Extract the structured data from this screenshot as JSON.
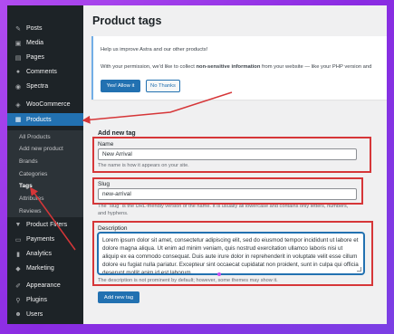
{
  "colors": {
    "admin_bar_bg": "#1d2327",
    "active_menu_bg": "#2271b1",
    "primary_button": "#2271b1",
    "highlight_red": "#d63638",
    "background_gradient": "#8a2be2"
  },
  "sidebar": {
    "items": [
      {
        "label": "Posts",
        "icon": "pin-icon"
      },
      {
        "label": "Media",
        "icon": "media-icon"
      },
      {
        "label": "Pages",
        "icon": "pages-icon"
      },
      {
        "label": "Comments",
        "icon": "comment-icon"
      },
      {
        "label": "Spectra",
        "icon": "spectra-icon"
      },
      {
        "label": "WooCommerce",
        "icon": "woocommerce-icon"
      },
      {
        "label": "Products",
        "icon": "products-icon"
      }
    ],
    "submenu": [
      {
        "label": "All Products"
      },
      {
        "label": "Add new product"
      },
      {
        "label": "Brands"
      },
      {
        "label": "Categories"
      },
      {
        "label": "Tags"
      },
      {
        "label": "Attributes"
      },
      {
        "label": "Reviews"
      }
    ],
    "items_bottom": [
      {
        "label": "Product Filters",
        "icon": "filter-icon"
      },
      {
        "label": "Payments",
        "icon": "payments-icon"
      },
      {
        "label": "Analytics",
        "icon": "analytics-icon"
      },
      {
        "label": "Marketing",
        "icon": "marketing-icon"
      },
      {
        "label": "Appearance",
        "icon": "appearance-icon"
      },
      {
        "label": "Plugins",
        "icon": "plugins-icon"
      },
      {
        "label": "Users",
        "icon": "users-icon"
      }
    ]
  },
  "page": {
    "title": "Product tags"
  },
  "notice": {
    "line1": "Help us improve Astra and our other products!",
    "line2_pre": "With your permission, we'd like to collect ",
    "line2_bold": "non-sensitive information",
    "line2_post": " from your website — like your PHP version and",
    "allow_label": "Yes! Allow it",
    "decline_label": "No Thanks"
  },
  "form": {
    "heading": "Add new tag",
    "name_label": "Name",
    "name_value": "New Arrival",
    "name_help": "The name is how it appears on your site.",
    "slug_label": "Slug",
    "slug_value": "new-arrival",
    "slug_help_1": "The “slug” is the URL-friendly version of the name. It is usually all lowercase and contains only letters, numbers,",
    "slug_help_2": "and hyphens.",
    "description_label": "Description",
    "description_value": "Lorem ipsum dolor sit amet, consectetur adipiscing elit, sed do eiusmod tempor incididunt ut labore et dolore magna aliqua. Ut enim ad minim veniam, quis nostrud exercitation ullamco laboris nisi ut aliquip ex ea commodo consequat. Duis aute irure dolor in reprehenderit in voluptate velit esse cillum dolore eu fugiat nulla pariatur. Excepteur sint occaecat cupidatat non proident, sunt in culpa qui officia deserunt mollit anim id est laborum.",
    "description_help": "The description is not prominent by default; however, some themes may show it.",
    "submit_label": "Add new tag"
  }
}
